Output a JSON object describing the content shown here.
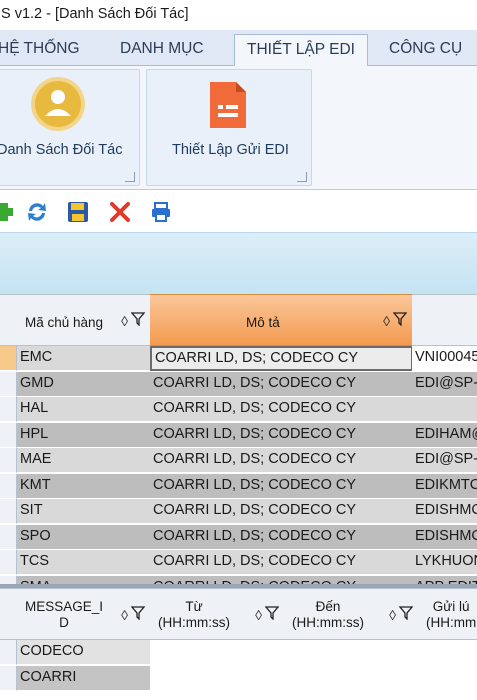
{
  "window": {
    "title": "S v1.2 - [Danh Sách Đối Tác]"
  },
  "tabs": [
    "HỆ THỐNG",
    "DANH MỤC",
    "THIẾT LẬP EDI",
    "CÔNG CỤ"
  ],
  "ribbon": {
    "buttons": [
      {
        "label": "Danh Sách Đối Tác",
        "icon": "user-circle-icon"
      },
      {
        "label": "Thiết Lập Gửi EDI",
        "icon": "document-list-icon"
      }
    ]
  },
  "toolbar": {
    "icons": [
      "add-icon",
      "refresh-icon",
      "save-icon",
      "delete-icon",
      "print-icon"
    ]
  },
  "grid1": {
    "columns": [
      "Mã chủ hàng",
      "Mô tả"
    ],
    "rows": [
      {
        "code": "EMC",
        "desc": "COARRI LD,  DS; CODECO CY",
        "email": "VNI00045"
      },
      {
        "code": "GMD",
        "desc": "COARRI LD,  DS; CODECO CY",
        "email": "EDI@SP-I"
      },
      {
        "code": "HAL",
        "desc": "COARRI LD,  DS; CODECO CY",
        "email": ""
      },
      {
        "code": "HPL",
        "desc": "COARRI LD,  DS; CODECO CY",
        "email": "EDIHAM@"
      },
      {
        "code": "MAE",
        "desc": "COARRI LD,  DS; CODECO CY",
        "email": "EDI@SP-I"
      },
      {
        "code": "KMT",
        "desc": "COARRI LD,  DS; CODECO CY",
        "email": "EDIKMTC"
      },
      {
        "code": "SIT",
        "desc": "COARRI LD,  DS; CODECO CY",
        "email": "EDISHMC"
      },
      {
        "code": "SPO",
        "desc": "COARRI LD,  DS; CODECO CY",
        "email": "EDISHMC"
      },
      {
        "code": "TCS",
        "desc": "COARRI LD,  DS; CODECO CY",
        "email": "LYKHUON"
      },
      {
        "code": "SMA",
        "desc": "COARRI LD,  DS; CODECO CY",
        "email": "APP EDIT"
      }
    ]
  },
  "grid2": {
    "columns": [
      "MESSAGE_I\nD",
      "Từ\n(HH:mm:ss)",
      "Đến\n(HH:mm:ss)",
      "Gửi lú\n(HH:mm"
    ],
    "rows": [
      {
        "message_id": "CODECO"
      },
      {
        "message_id": "COARRI"
      }
    ]
  },
  "sort_glyph": "◊",
  "colors": {
    "accent_orange": "#f39a4f",
    "ribbon_bg": "#e9f0f9",
    "header_band": "#c6e3f2"
  }
}
